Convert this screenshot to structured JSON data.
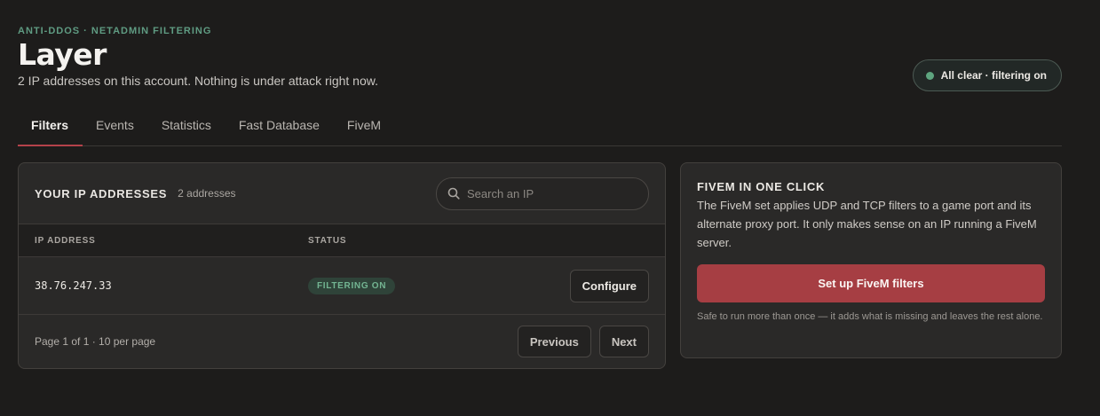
{
  "header": {
    "eyebrow": "ANTI-DDOS · NETADMIN FILTERING",
    "title": "Layer",
    "subtitle": "2 IP addresses on this account. Nothing is under attack right now.",
    "status": "All clear · filtering on",
    "status_color": "#5ea57f"
  },
  "tabs": [
    {
      "label": "Filters",
      "active": true
    },
    {
      "label": "Events"
    },
    {
      "label": "Statistics"
    },
    {
      "label": "Fast Database"
    },
    {
      "label": "FiveM"
    }
  ],
  "ip_card": {
    "title": "YOUR IP ADDRESSES",
    "count": "2 addresses",
    "search_placeholder": "Search an IP",
    "columns": [
      "IP ADDRESS",
      "STATUS"
    ],
    "rows": [
      {
        "ip": "38.76.247.33",
        "status": "FILTERING ON",
        "action": "Configure"
      }
    ],
    "page_info": "Page 1 of 1 · 10 per page",
    "prev_label": "Previous",
    "next_label": "Next"
  },
  "fivem_card": {
    "title": "FIVEM IN ONE CLICK",
    "description": "The FiveM set applies UDP and TCP filters to a game port and its alternate proxy port. It only makes sense on an IP running a FiveM server.",
    "button": "Set up FiveM filters",
    "note": "Safe to run more than once — it adds what is missing and leaves the rest alone.",
    "accent": "#a63e43"
  }
}
